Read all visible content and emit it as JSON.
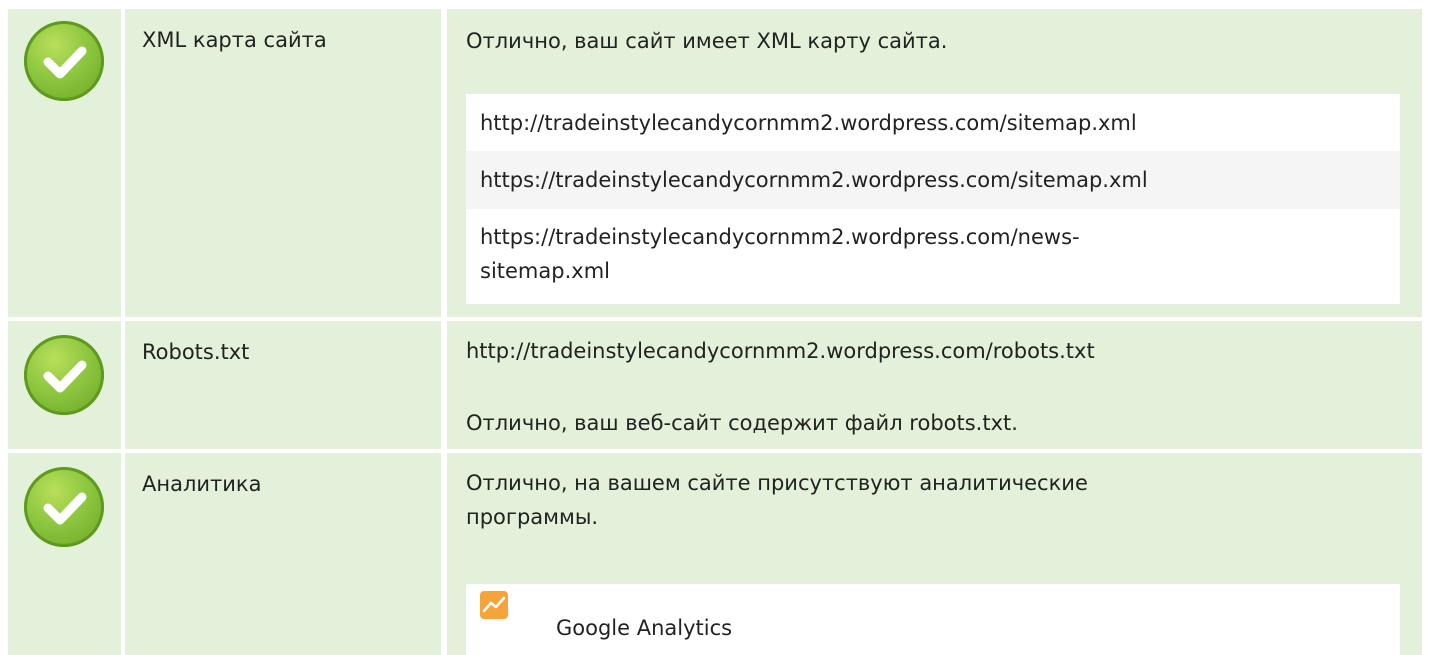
{
  "rows": [
    {
      "name": "XML карта сайта",
      "message": "Отлично, ваш сайт имеет XML карту сайта.",
      "sitemaps": [
        "http://tradeinstylecandycornmm2.wordpress.com/sitemap.xml",
        "https://tradeinstylecandycornmm2.wordpress.com/sitemap.xml",
        "https://tradeinstylecandycornmm2.wordpress.com/news-sitemap.xml"
      ],
      "status_icon": "check-icon"
    },
    {
      "name": "Robots.txt",
      "robots_url": "http://tradeinstylecandycornmm2.wordpress.com/robots.txt",
      "message": "Отлично, ваш веб-сайт содержит файл robots.txt.",
      "status_icon": "check-icon"
    },
    {
      "name": "Аналитика",
      "message": "Отлично, на вашем сайте присутствуют аналитические программы.",
      "tools": [
        {
          "label": "Google Analytics",
          "icon": "google-analytics-icon"
        }
      ],
      "status_icon": "check-icon"
    }
  ],
  "colors": {
    "row_bg": "#e3f1da",
    "check_green": "#8dc63f",
    "analytics_orange": "#f7a33c"
  }
}
